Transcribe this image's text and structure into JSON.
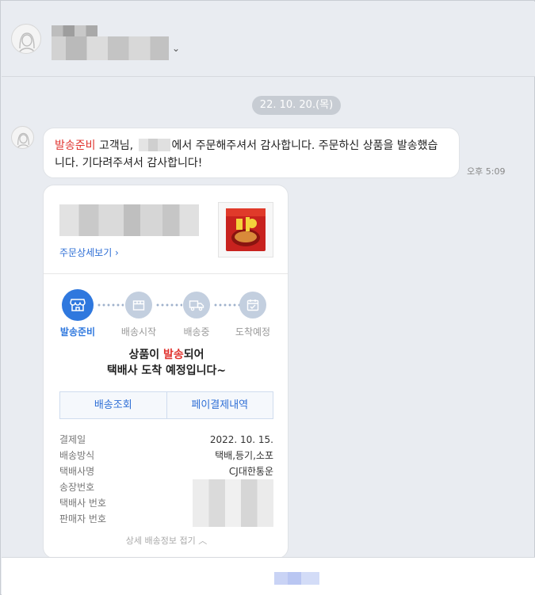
{
  "date_divider": "22. 10. 20.(목)",
  "message": {
    "highlight": "발송준비",
    "text_before_mask": " 고객님, ",
    "text_after_mask": "에서 주문해주셔서 감사합니다. 주문하신 상품을 발송했습니다. 기다려주셔서 감사합니다!",
    "time": "오후 5:09"
  },
  "card": {
    "detail_link": "주문상세보기 ›",
    "steps": [
      {
        "label": "발송준비",
        "icon": "store-icon",
        "active": true
      },
      {
        "label": "배송시작",
        "icon": "box-icon",
        "active": false
      },
      {
        "label": "배송중",
        "icon": "truck-icon",
        "active": false
      },
      {
        "label": "도착예정",
        "icon": "calendar-check-icon",
        "active": false
      }
    ],
    "status_line1_before": "상품이 ",
    "status_line1_highlight": "발송",
    "status_line1_after": "되어",
    "status_line2": "택배사 도착 예정입니다~",
    "buttons": {
      "track": "배송조회",
      "pay_history": "페이결제내역"
    },
    "info": [
      {
        "key": "결제일",
        "value": "2022. 10. 15."
      },
      {
        "key": "배송방식",
        "value": "택배,등기,소포"
      },
      {
        "key": "택배사명",
        "value": "CJ대한통운"
      },
      {
        "key": "송장번호",
        "value": ""
      },
      {
        "key": "택배사 번호",
        "value": ""
      },
      {
        "key": "판매자 번호",
        "value": ""
      }
    ],
    "collapse_label": "상세 배송정보 접기 ︿"
  },
  "colors": {
    "accent": "#2f78de",
    "highlight": "#e0342f",
    "background": "#e9ecf1"
  }
}
